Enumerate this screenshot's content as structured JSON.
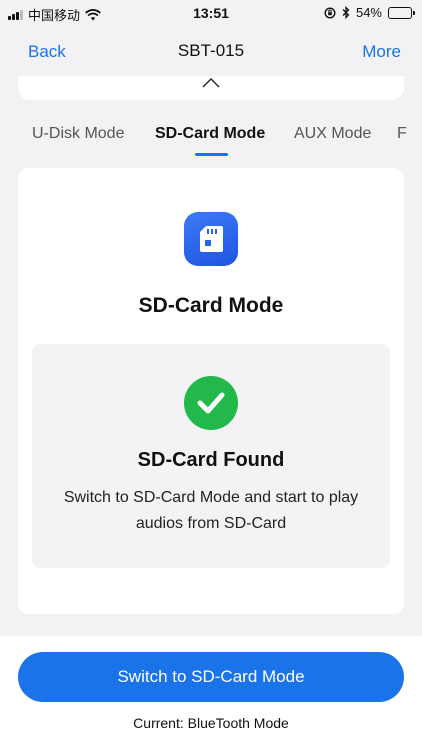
{
  "status_bar": {
    "carrier": "中国移动",
    "time": "13:51",
    "battery_text": "54%",
    "battery_level": 0.54
  },
  "nav": {
    "back_label": "Back",
    "title": "SBT-015",
    "more_label": "More"
  },
  "tabs": [
    {
      "label": "U-Disk Mode",
      "active": false
    },
    {
      "label": "SD-Card Mode",
      "active": true
    },
    {
      "label": "AUX Mode",
      "active": false
    },
    {
      "label": "F",
      "active": false
    }
  ],
  "card": {
    "icon": "sd-card-icon",
    "title": "SD-Card Mode",
    "status_icon": "check-circle-icon",
    "status_title": "SD-Card Found",
    "status_description": "Switch to SD-Card Mode and start to play audios from SD-Card"
  },
  "footer": {
    "switch_button_label": "Switch to SD-Card Mode",
    "current_mode_text": "Current: BlueTooth Mode"
  },
  "colors": {
    "accent": "#1a73e8",
    "success": "#22b84a",
    "background": "#f2f2f5"
  }
}
